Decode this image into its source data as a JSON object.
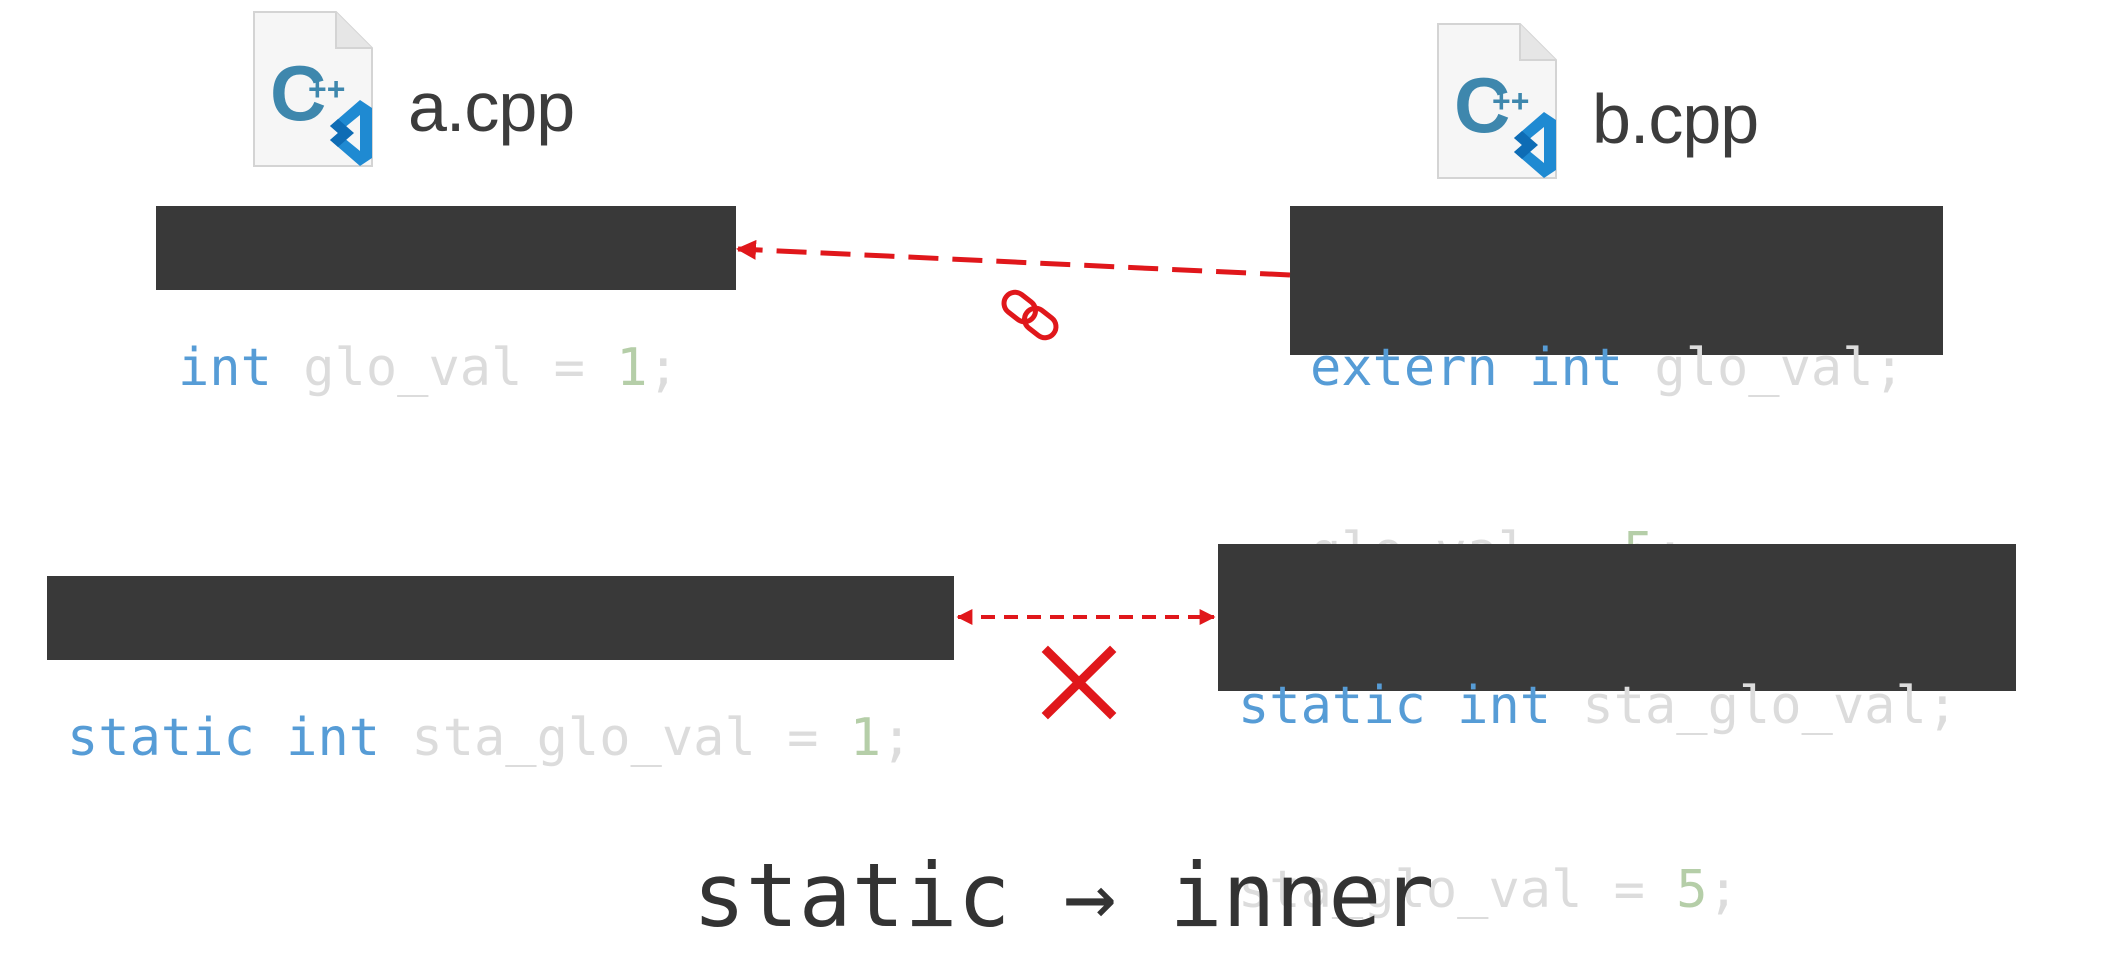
{
  "files": {
    "left": {
      "name": "a.cpp",
      "icon": "cpp-vscode-file-icon"
    },
    "right": {
      "name": "b.cpp",
      "icon": "cpp-vscode-file-icon"
    }
  },
  "icon_glyph": {
    "letter": "C",
    "plus": "++"
  },
  "code": {
    "a_global": {
      "kw1": "int",
      "rest1": " glo_val = ",
      "num1": "1",
      "end1": ";"
    },
    "b_global": {
      "kw1": "extern",
      "sp1": " ",
      "kw2": "int",
      "rest1": " glo_val;",
      "rest2": "glo_val = ",
      "num2": "5",
      "end2": ";"
    },
    "a_static": {
      "kw1": "static",
      "sp1": " ",
      "kw2": "int",
      "rest1": " sta_glo_val = ",
      "num1": "1",
      "end1": ";"
    },
    "b_static": {
      "kw1": "static",
      "sp1": " ",
      "kw2": "int",
      "rest1": " sta_glo_val;",
      "rest2": "sta_glo_val = ",
      "num2": "5",
      "end2": ";"
    }
  },
  "connections": {
    "linked": {
      "style": "dashed",
      "color": "#e0171b",
      "icon": "link-icon",
      "status": "linked"
    },
    "blocked": {
      "style": "dashed",
      "color": "#e0171b",
      "icon": "cross-icon",
      "status": "not-linked"
    }
  },
  "caption": "static → inner",
  "colors": {
    "keyword": "#569cd6",
    "number": "#b5cea8",
    "code_bg": "#393939",
    "accent_red": "#e0171b"
  }
}
